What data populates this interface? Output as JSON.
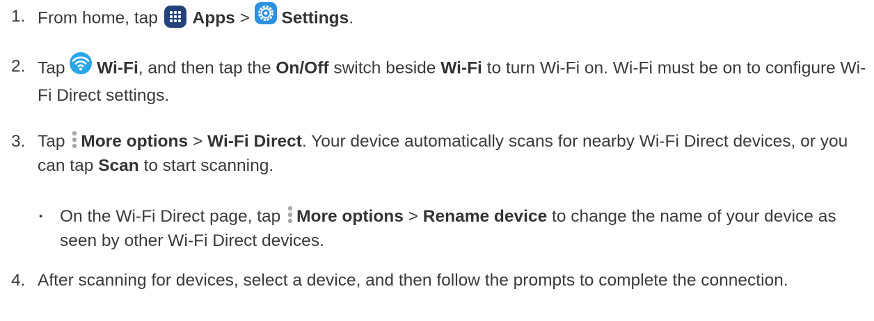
{
  "steps": [
    {
      "number": "1.",
      "t1": "From home, tap ",
      "b1": "Apps",
      "t2": " > ",
      "b2": "Settings",
      "t3": "."
    },
    {
      "number": "2.",
      "t1": "Tap ",
      "b1": "Wi-Fi",
      "t2": ", and then tap the ",
      "b2": "On/Off",
      "t3": " switch beside ",
      "b3": "Wi-Fi",
      "t4": " to turn Wi-Fi on. Wi-Fi must be on to configure Wi-Fi Direct settings."
    },
    {
      "number": "3.",
      "t1": "Tap ",
      "b1": "More options",
      "t2": " > ",
      "b2": "Wi-Fi Direct",
      "t3": ". Your device automatically scans for nearby Wi-Fi Direct devices, or you can tap ",
      "b3": "Scan",
      "t4": " to start scanning."
    },
    {
      "number": "4.",
      "t1": "After scanning for devices, select a device, and then follow the prompts to complete the connection."
    }
  ],
  "subitem": {
    "bullet": "•",
    "t1": "On the Wi-Fi Direct page, tap ",
    "b1": "More options",
    "t2": " > ",
    "b2": "Rename device",
    "t3": " to change the name of your device as seen by other Wi-Fi Direct devices."
  },
  "icons": {
    "apps": "apps-icon",
    "settings": "settings-icon",
    "wifi": "wifi-icon",
    "more_options": "more-options-icon"
  },
  "colors": {
    "text": "#3a3a3a",
    "apps_icon_bg": "#24427a",
    "settings_icon_bg": "#2c8fe0",
    "wifi_icon_bg": "#2aa6ea",
    "dots": "#a8a8a8"
  }
}
